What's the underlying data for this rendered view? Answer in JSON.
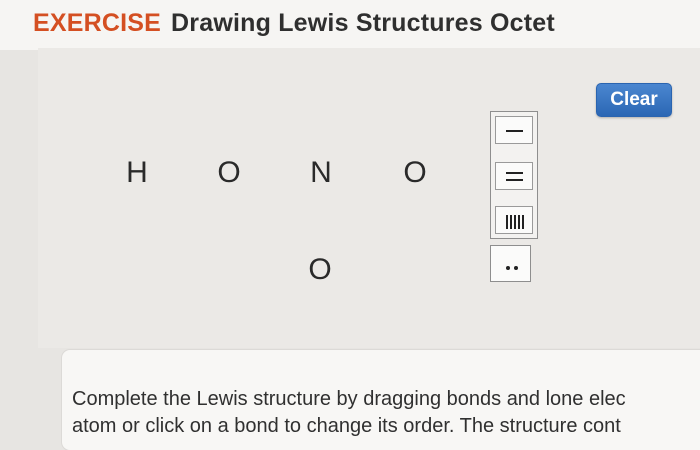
{
  "header": {
    "exercise_label": "EXERCISE",
    "title": "Drawing Lewis Structures Octet"
  },
  "toolbar": {
    "clear_label": "Clear"
  },
  "atoms": [
    "H",
    "O",
    "N",
    "O",
    "O"
  ],
  "palette": {
    "bond_icons": [
      "single-bond-icon",
      "double-bond-icon",
      "triple-bond-icon"
    ],
    "lone_pair_icon": "lone-pair-icon"
  },
  "instructions": {
    "line1": "Complete the Lewis structure by dragging bonds and lone elec",
    "line2": "atom or click on a bond to change its order. The structure cont"
  },
  "colors": {
    "exercise_accent": "#d44f22",
    "button_blue": "#2b67b4"
  }
}
